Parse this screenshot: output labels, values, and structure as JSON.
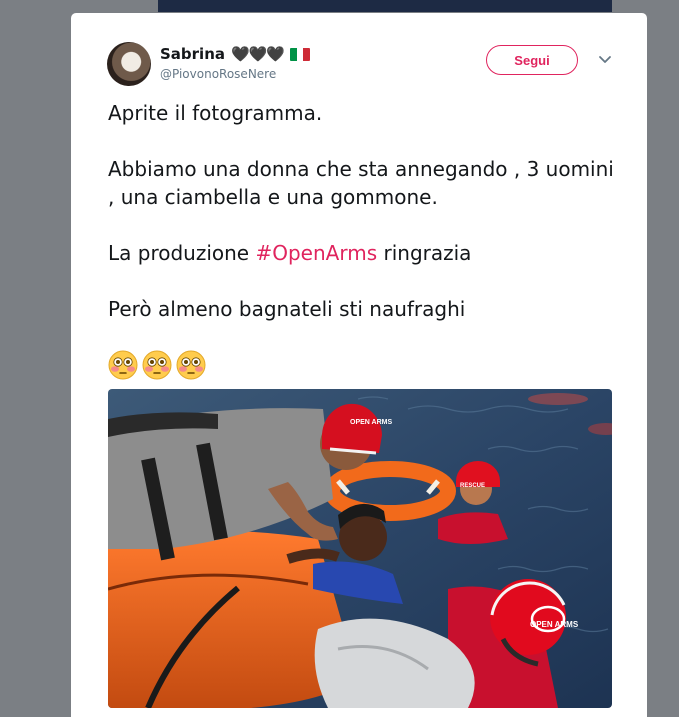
{
  "tweet": {
    "display_name": "Sabrina",
    "name_emoji": "🖤🖤🖤",
    "handle": "@PiovonoRoseNere",
    "follow_label": "Segui",
    "text_line1": "Aprite il fotogramma.",
    "text_para2": "Abbiamo una donna che sta annegando , 3 uomini , una ciambella e una gommone.",
    "text_para3_before": "La produzione ",
    "text_hashtag": "#OpenArms",
    "text_para3_after": " ringrazia",
    "text_para4": "Però almeno bagnateli sti naufraghi",
    "emoji_count": 3,
    "emoji_name": "flushed-face"
  },
  "photo": {
    "helmet_text_1": "OPEN ARMS",
    "helmet_text_2": "RESCUE",
    "helmet_text_3": "OPEN ARMS"
  },
  "colors": {
    "accent": "#e0245e",
    "text": "#14171a",
    "muted": "#657786",
    "backdrop": "#7b7f84"
  }
}
